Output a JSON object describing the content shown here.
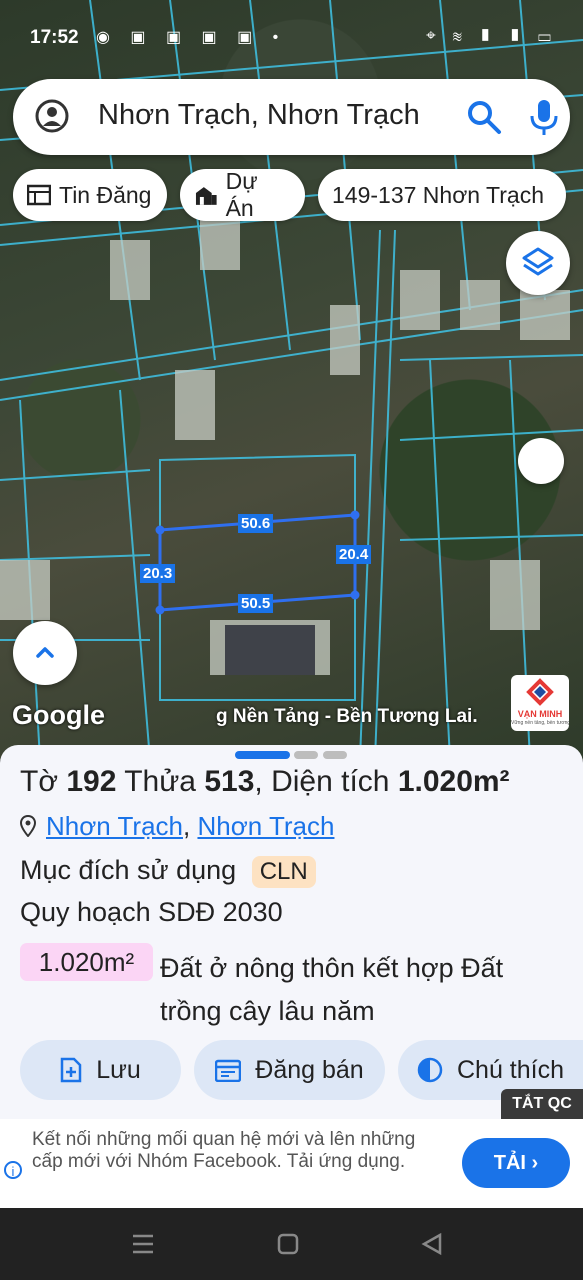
{
  "status_bar": {
    "time": "17:52",
    "left_icons": "◉ ▣ ▣ ▣ ▣ •",
    "right_icons": "⌖ ≋ ▮ ▮ ▭"
  },
  "search": {
    "query": "Nhơn Trạch, Nhơn Trạch"
  },
  "chips": [
    {
      "label": "Tin Đăng",
      "icon": "listing-icon"
    },
    {
      "label": "Dự Án",
      "icon": "building-icon"
    },
    {
      "label": "149-137 Nhơn Trạch",
      "icon": ""
    }
  ],
  "map": {
    "edge_labels": {
      "top": "50.6",
      "bottom": "50.5",
      "left": "20.3",
      "right": "20.4"
    },
    "watermark": "Google",
    "marquee": "g Nền Tảng - Bền Tương Lai.",
    "logo_text": "VẠN MINH",
    "logo_sub": "Vững nền tảng, bền tương lai"
  },
  "parcel": {
    "sheet_label": "Tờ",
    "sheet_no": "192",
    "lot_label": "Thửa",
    "lot_no": "513",
    "area_label": "Diện tích",
    "area": "1.020m²",
    "location_1": "Nhơn Trạch",
    "location_sep": ",",
    "location_2": "Nhơn Trạch",
    "usage_label": "Mục đích sử dụng",
    "usage_code": "CLN",
    "plan_label": "Quy hoạch SDĐ 2030",
    "plan_area": "1.020m²",
    "plan_desc": "Đất ở nông thôn kết hợp Đất trồng cây lâu năm"
  },
  "actions": [
    {
      "label": "Lưu",
      "icon": "save-icon"
    },
    {
      "label": "Đăng bán",
      "icon": "calendar-icon"
    },
    {
      "label": "Chú thích",
      "icon": "legend-icon"
    }
  ],
  "ad": {
    "close_label": "TẮT QC",
    "text": "Kết nối những mối quan hệ mới và lên những cấp mới với Nhóm Facebook. Tải ứng dụng.",
    "cta": "TẢI"
  },
  "colors": {
    "accent": "#1a73e8",
    "parcel_line": "#3b82f6",
    "usage_badge": "#fde2c2",
    "plan_badge": "#fbd5f5"
  }
}
